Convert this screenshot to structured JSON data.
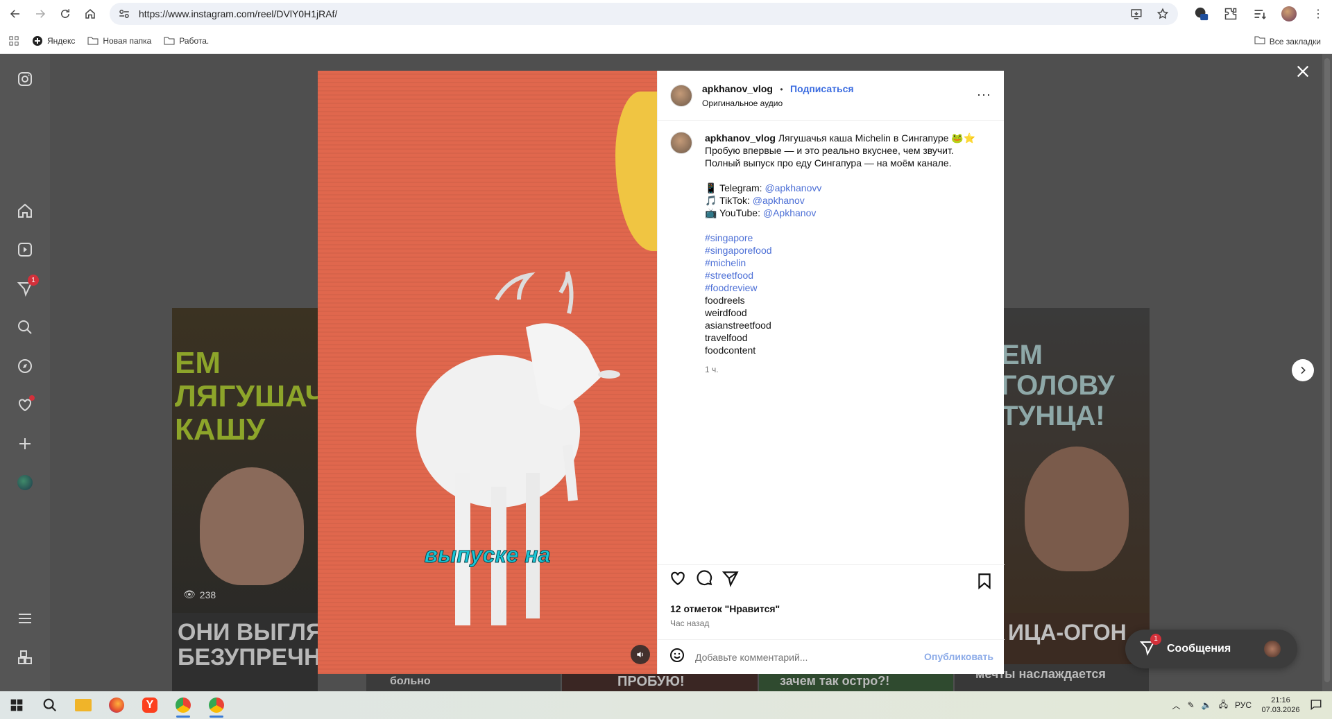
{
  "browser": {
    "url": "https://www.instagram.com/reel/DVlY0H1jRAf/",
    "bookmarks": [
      {
        "label": "Яндекс"
      },
      {
        "label": "Новая папка"
      },
      {
        "label": "Работа."
      }
    ],
    "all_bookmarks": "Все закладки"
  },
  "background_reels": {
    "left_views": "238",
    "left_title_top": "ЕМ ЛЯГУШАЧ КАШУ",
    "left_bottom_text": "ОНИ ВЫГЛЯ БЕЗУПРЕЧНО",
    "right_title_top": "ЕМ ГОЛОВУ ТУНЦА!",
    "right_bottom_text": "ИЦА-ОГОН",
    "strip_texts": [
      "больно",
      "ПРОБУЮ!",
      "зачем так остро?!",
      "мечты наслаждается"
    ]
  },
  "video": {
    "caption": "выпуске на"
  },
  "post": {
    "username": "apkhanov_vlog",
    "separator": "•",
    "follow_label": "Подписаться",
    "audio": "Оригинальное аудио",
    "more": "···",
    "caption_first": "Лягушачья каша Michelin в Сингапуре 🐸⭐",
    "caption_lines": [
      "Пробую впервые — и это реально вкуснее, чем звучит.",
      "Полный выпуск про еду Сингапура — на моём канале."
    ],
    "socials": [
      {
        "label": "Telegram:",
        "handle": "@apkhanovv",
        "emoji": "📱"
      },
      {
        "label": "TikTok:",
        "handle": "@apkhanov",
        "emoji": "🎵"
      },
      {
        "label": "YouTube:",
        "handle": "@Apkhanov",
        "emoji": "📺"
      }
    ],
    "hashtags_linked": [
      "#singapore",
      "#singaporefood",
      "#michelin",
      "#streetfood",
      "#foodreview"
    ],
    "tags_plain": [
      "foodreels",
      "weirdfood",
      "asianstreetfood",
      "travelfood",
      "foodcontent"
    ],
    "caption_time": "1 ч.",
    "likes": "12 отметок \"Нравится\"",
    "posted": "Час назад",
    "comment_placeholder": "Добавьте комментарий...",
    "publish_label": "Опубликовать"
  },
  "messages": {
    "label": "Сообщения",
    "badge": "1"
  },
  "sidebar": {
    "notification_badge": "1"
  },
  "taskbar": {
    "lang": "РУС",
    "time": "21:16",
    "date": "07.03.2026"
  }
}
